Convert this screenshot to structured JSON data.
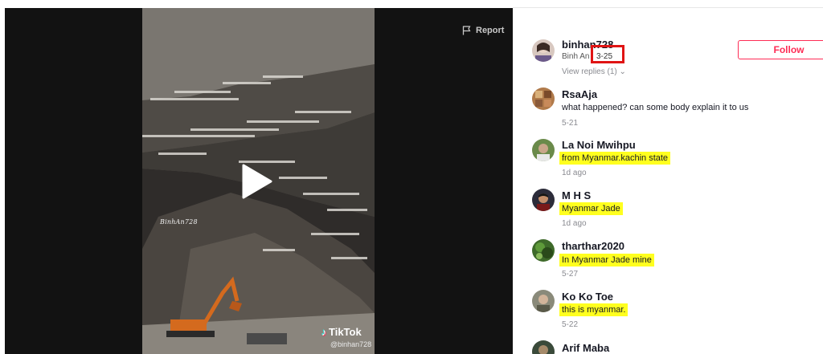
{
  "video": {
    "report_label": "Report",
    "watermark_text": "BinhAn728",
    "tiktok_label": "TikTok",
    "tiktok_handle": "@binhan728"
  },
  "header_comment": {
    "username": "binhan728",
    "subname": "Binh An",
    "date": "3-25",
    "view_replies": "View replies (1)",
    "follow_label": "Follow"
  },
  "comments": [
    {
      "username": "RsaAja",
      "text": "what happened? can some body explain it to us",
      "date": "5-21",
      "highlighted": false
    },
    {
      "username": "La Noi Mwihpu",
      "text": "from Myanmar.kachin state",
      "date": "1d ago",
      "highlighted": true
    },
    {
      "username": "M H S",
      "text": "Myanmar Jade",
      "date": "1d ago",
      "highlighted": true
    },
    {
      "username": "tharthar2020",
      "text": "In Myanmar Jade mine",
      "date": "5-27",
      "highlighted": true
    },
    {
      "username": "Ko Ko Toe",
      "text": "this is myanmar.",
      "date": "5-22",
      "highlighted": true
    },
    {
      "username": "Arif Maba",
      "text": "",
      "date": "",
      "highlighted": false
    }
  ],
  "colors": {
    "highlight": "#ffff1f",
    "follow_accent": "#fe2c55",
    "annotation_box": "#e01414"
  }
}
